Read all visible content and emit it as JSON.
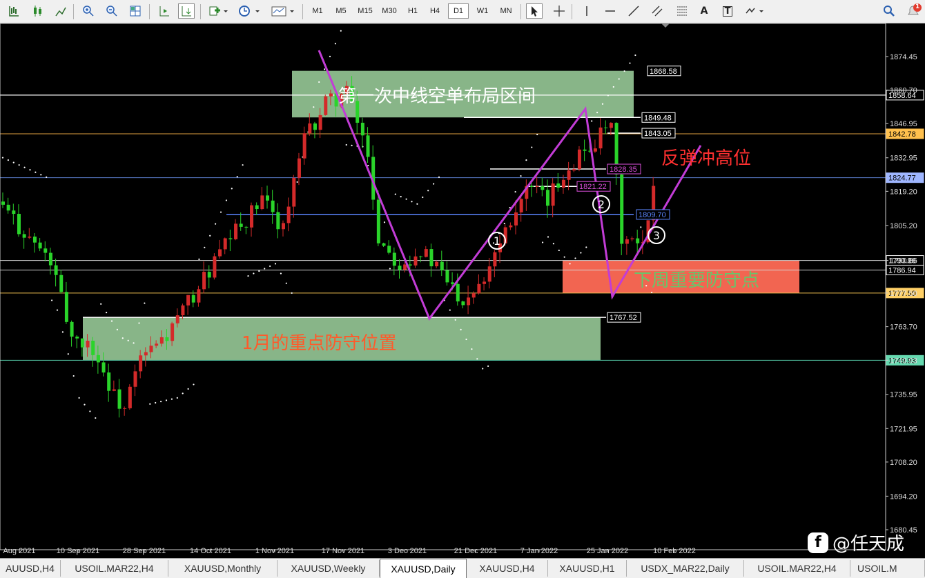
{
  "toolbar": {
    "timeframes": [
      "M1",
      "M5",
      "M15",
      "M30",
      "H1",
      "H4",
      "D1",
      "W1",
      "MN"
    ],
    "active_timeframe": "D1",
    "text_tool_label": "A",
    "textbox_tool_label": "T",
    "notification_count": "1"
  },
  "chart_data": {
    "type": "candlestick",
    "symbol": "XAUUSD",
    "timeframe": "Daily",
    "ylim": [
      1675,
      1883
    ],
    "y_ticks": [
      "1874.45",
      "1860.70",
      "1846.95",
      "1832.95",
      "1819.20",
      "1805.20",
      "1790.86",
      "1777.50",
      "1763.70",
      "1749.93",
      "1735.95",
      "1721.95",
      "1708.20",
      "1694.20",
      "1680.45"
    ],
    "x_ticks": [
      "Aug 2021",
      "10 Sep 2021",
      "28 Sep 2021",
      "14 Oct 2021",
      "1 Nov 2021",
      "17 Nov 2021",
      "3 Dec 2021",
      "21 Dec 2021",
      "7 Jan 2022",
      "25 Jan 2022",
      "10 Feb 2022"
    ],
    "price_labels": [
      {
        "value": "1858.64",
        "color": "#ffffff"
      },
      {
        "value": "1842.78",
        "color": "#ffc04d"
      },
      {
        "value": "1824.77",
        "color": "#9fb6ff"
      },
      {
        "value": "1790.86",
        "color": "#ffffff"
      },
      {
        "value": "1786.94",
        "color": "#ffffff"
      },
      {
        "value": "1777.50",
        "color": "#ffd066"
      },
      {
        "value": "1749.93",
        "color": "#66d9b0"
      }
    ],
    "level_labels": [
      {
        "text": "1868.58",
        "price": 1868.58,
        "color": "#ffffff"
      },
      {
        "text": "1849.48",
        "price": 1849.48,
        "color": "#ffffff"
      },
      {
        "text": "1843.05",
        "price": 1843.05,
        "color": "#ffffff"
      },
      {
        "text": "1828.35",
        "price": 1828.35,
        "color": "#d94fd9"
      },
      {
        "text": "1821.22",
        "price": 1821.22,
        "color": "#d94fd9"
      },
      {
        "text": "1809.70",
        "price": 1809.7,
        "color": "#5b86ff"
      },
      {
        "text": "1767.52",
        "price": 1767.52,
        "color": "#ffffff"
      }
    ],
    "zones": [
      {
        "label": "第一次中线空单布局区间",
        "top": 1868.6,
        "bottom": 1849.5,
        "fill": "#8fbf8f",
        "text_color": "#ffffff"
      },
      {
        "label": "下周重要防守点",
        "top": 1790.9,
        "bottom": 1777.5,
        "fill": "#ff6a55",
        "text_color": "#6ac46a"
      },
      {
        "label": "1月的重点防守位置",
        "top": 1767.5,
        "bottom": 1749.9,
        "fill": "#8fbf8f",
        "text_color": "#ff5a2a"
      }
    ],
    "annotations": [
      {
        "text": "反弹冲高位",
        "color": "#ff3030"
      },
      {
        "text": "1"
      },
      {
        "text": "2"
      },
      {
        "text": "3"
      }
    ],
    "pattern_points": [
      {
        "date": "17 Nov 2021",
        "price": 1877
      },
      {
        "date": "15 Dec 2021",
        "price": 1753
      },
      {
        "date": "25 Jan 2022",
        "price": 1853
      },
      {
        "date": "28 Jan 2022",
        "price": 1780
      },
      {
        "date": "14 Feb 2022",
        "price": 1840
      }
    ]
  },
  "tabs": [
    "AUUSD,H4",
    "USOIL.MAR22,H4",
    "XAUUSD,Monthly",
    "XAUUSD,Weekly",
    "XAUUSD,Daily",
    "XAUUSD,H4",
    "XAUUSD,H1",
    "USDX_MAR22,Daily",
    "USOIL.MAR22,H4",
    "USOIL.M"
  ],
  "active_tab": "XAUUSD,Daily",
  "watermark": "@任天成"
}
